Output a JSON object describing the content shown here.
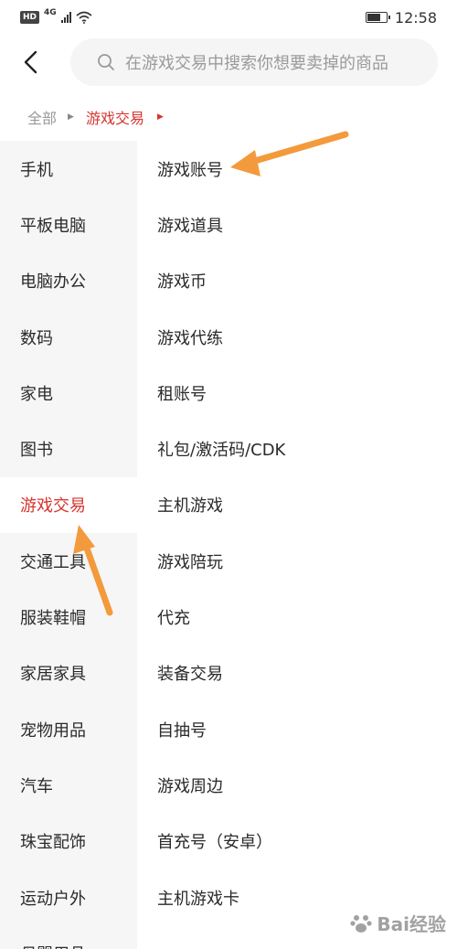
{
  "status_bar": {
    "hd_label": "HD",
    "network_label": "4G",
    "time": "12:58",
    "battery_level": 0.75
  },
  "header": {
    "back_icon": "chevron-left-icon",
    "search_icon": "search-icon",
    "search_placeholder": "在游戏交易中搜索你想要卖掉的商品"
  },
  "breadcrumb": {
    "root": "全部",
    "current": "游戏交易"
  },
  "sidebar": {
    "active_index": 6,
    "items": [
      {
        "label": "手机"
      },
      {
        "label": "平板电脑"
      },
      {
        "label": "电脑办公"
      },
      {
        "label": "数码"
      },
      {
        "label": "家电"
      },
      {
        "label": "图书"
      },
      {
        "label": "游戏交易"
      },
      {
        "label": "交通工具"
      },
      {
        "label": "服装鞋帽"
      },
      {
        "label": "家居家具"
      },
      {
        "label": "宠物用品"
      },
      {
        "label": "汽车"
      },
      {
        "label": "珠宝配饰"
      },
      {
        "label": "运动户外"
      },
      {
        "label": "母婴用品"
      }
    ]
  },
  "subcategories": {
    "items": [
      {
        "label": "游戏账号"
      },
      {
        "label": "游戏道具"
      },
      {
        "label": "游戏币"
      },
      {
        "label": "游戏代练"
      },
      {
        "label": "租账号"
      },
      {
        "label": "礼包/激活码/CDK"
      },
      {
        "label": "主机游戏"
      },
      {
        "label": "游戏陪玩"
      },
      {
        "label": "代充"
      },
      {
        "label": "装备交易"
      },
      {
        "label": "自抽号"
      },
      {
        "label": "游戏周边"
      },
      {
        "label": "首充号（安卓）"
      },
      {
        "label": "主机游戏卡"
      }
    ]
  },
  "colors": {
    "accent": "#d6352e",
    "annotation_arrow": "#f39a3c",
    "sidebar_bg": "#f6f6f6"
  },
  "watermark": {
    "text": "Bai经验"
  }
}
